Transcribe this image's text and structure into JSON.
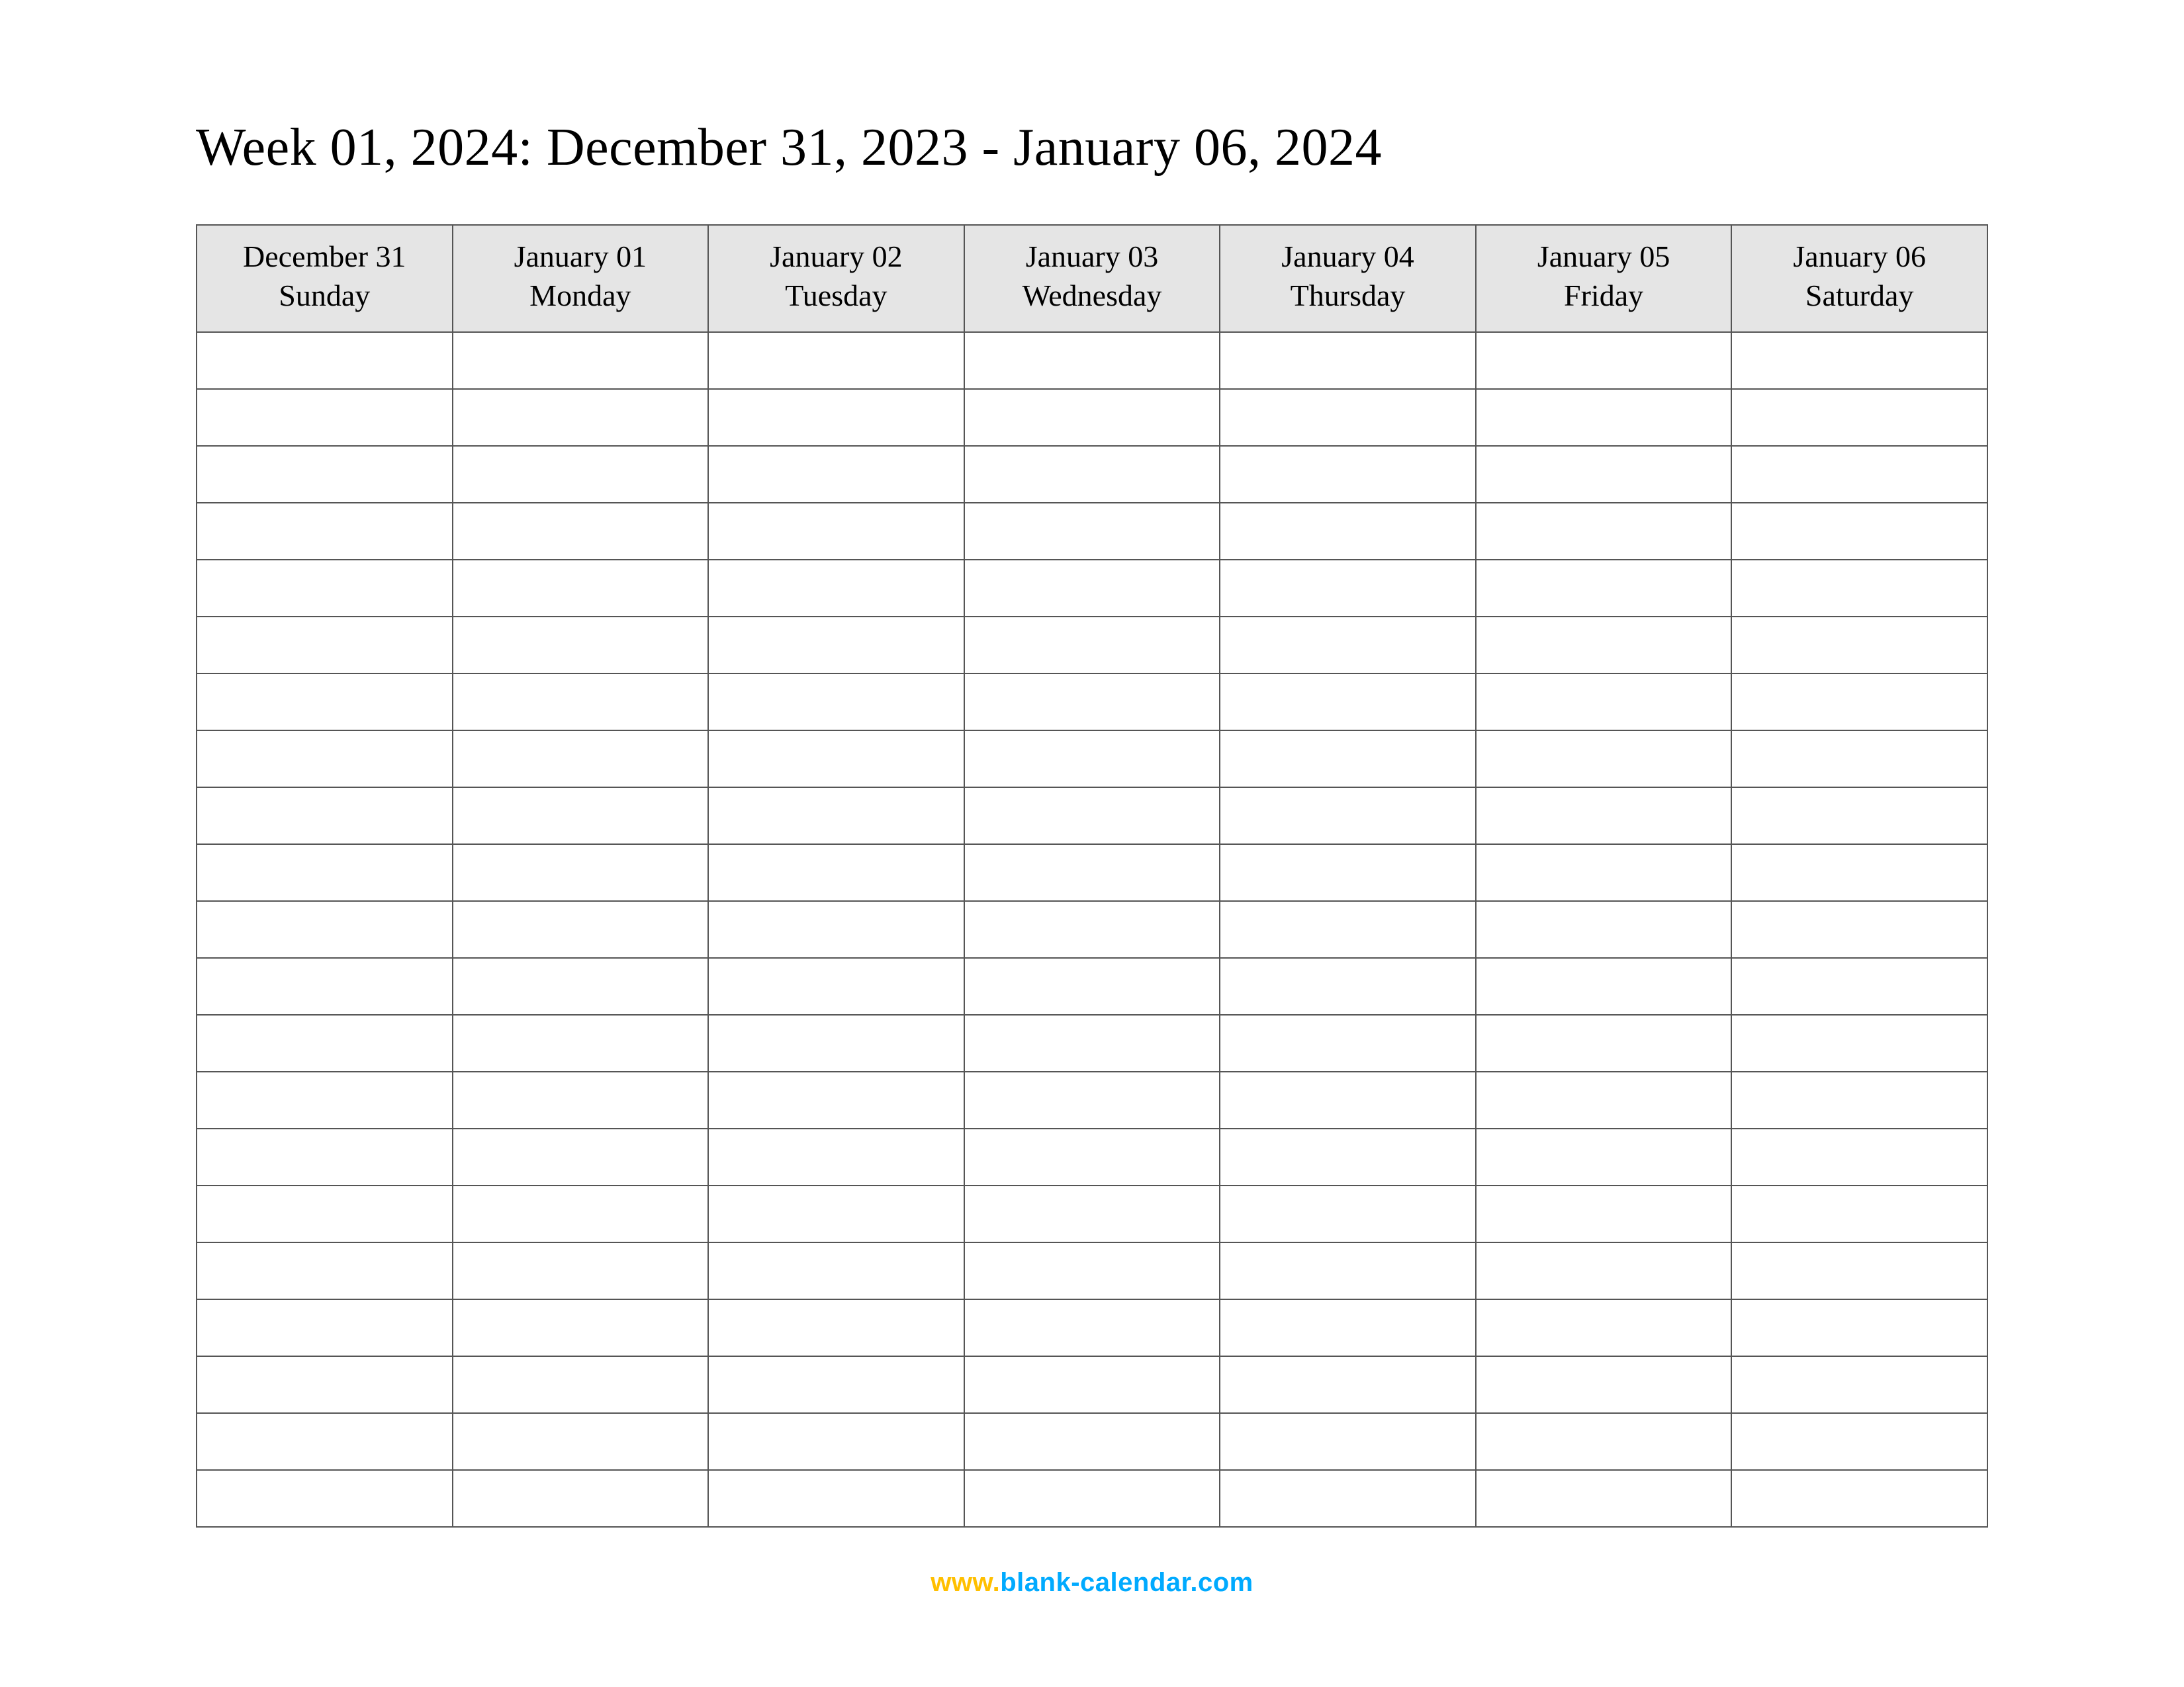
{
  "title": "Week 01, 2024: December 31, 2023 - January 06, 2024",
  "days": [
    {
      "date": "December 31",
      "weekday": "Sunday"
    },
    {
      "date": "January 01",
      "weekday": "Monday"
    },
    {
      "date": "January 02",
      "weekday": "Tuesday"
    },
    {
      "date": "January 03",
      "weekday": "Wednesday"
    },
    {
      "date": "January 04",
      "weekday": "Thursday"
    },
    {
      "date": "January 05",
      "weekday": "Friday"
    },
    {
      "date": "January 06",
      "weekday": "Saturday"
    }
  ],
  "row_count": 21,
  "footer": {
    "part1": "www.",
    "part2": "blank-calendar.com"
  }
}
